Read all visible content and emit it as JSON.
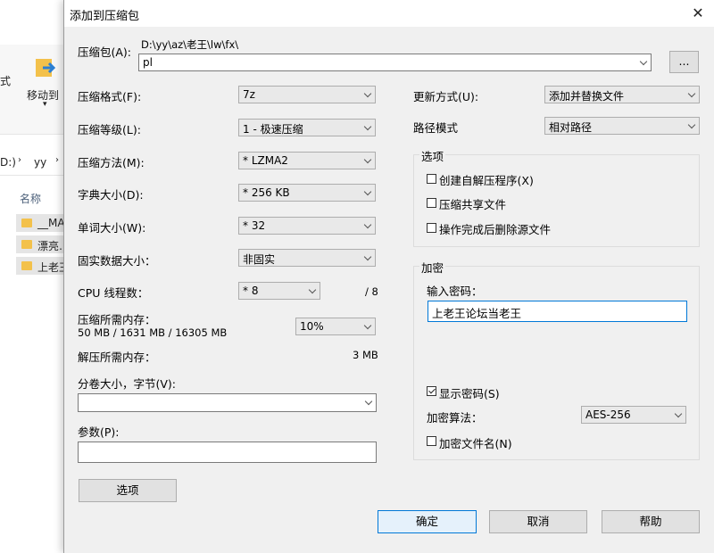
{
  "explorer": {
    "toolbar_partial": "式",
    "move_to": "移动到",
    "address_drive": "D:)",
    "address_folder": "yy",
    "column_name": "名称",
    "files": [
      "__MA",
      "漂亮…",
      "上老王"
    ]
  },
  "dialog": {
    "title": "添加到压缩包",
    "archive": {
      "label": "压缩包(A):",
      "path": "D:\\yy\\az\\老王\\lw\\fx\\",
      "value": "pl",
      "browse_label": "..."
    },
    "left": {
      "format": {
        "label": "压缩格式(F):",
        "value": "7z"
      },
      "level": {
        "label": "压缩等级(L):",
        "value": "1 - 极速压缩"
      },
      "method": {
        "label": "压缩方法(M):",
        "value": "* LZMA2"
      },
      "dict": {
        "label": "字典大小(D):",
        "value": "* 256 KB"
      },
      "word": {
        "label": "单词大小(W):",
        "value": "* 32"
      },
      "solid": {
        "label": "固实数据大小：",
        "value": "非固实"
      },
      "cpu": {
        "label": "CPU 线程数：",
        "value": "* 8",
        "max": "/ 8"
      },
      "mem_compress": {
        "label": "压缩所需内存：",
        "detail": "50 MB / 1631 MB / 16305 MB",
        "percent": "10%"
      },
      "mem_decompress": {
        "label": "解压所需内存：",
        "value": "3 MB"
      },
      "volume": {
        "label": "分卷大小，字节(V):",
        "value": ""
      },
      "params": {
        "label": "参数(P):",
        "value": ""
      },
      "options_button": "选项"
    },
    "right": {
      "update": {
        "label": "更新方式(U):",
        "value": "添加并替换文件"
      },
      "path_mode": {
        "label": "路径模式",
        "value": "相对路径"
      },
      "options_group": {
        "title": "选项",
        "sfx": "创建自解压程序(X)",
        "shared": "压缩共享文件",
        "delete": "操作完成后删除源文件"
      },
      "encryption": {
        "title": "加密",
        "password_label": "输入密码：",
        "password_value": "上老王论坛当老王",
        "show_password": "显示密码(S)",
        "method_label": "加密算法：",
        "method_value": "AES-256",
        "encrypt_names": "加密文件名(N)"
      }
    },
    "buttons": {
      "ok": "确定",
      "cancel": "取消",
      "help": "帮助"
    }
  }
}
